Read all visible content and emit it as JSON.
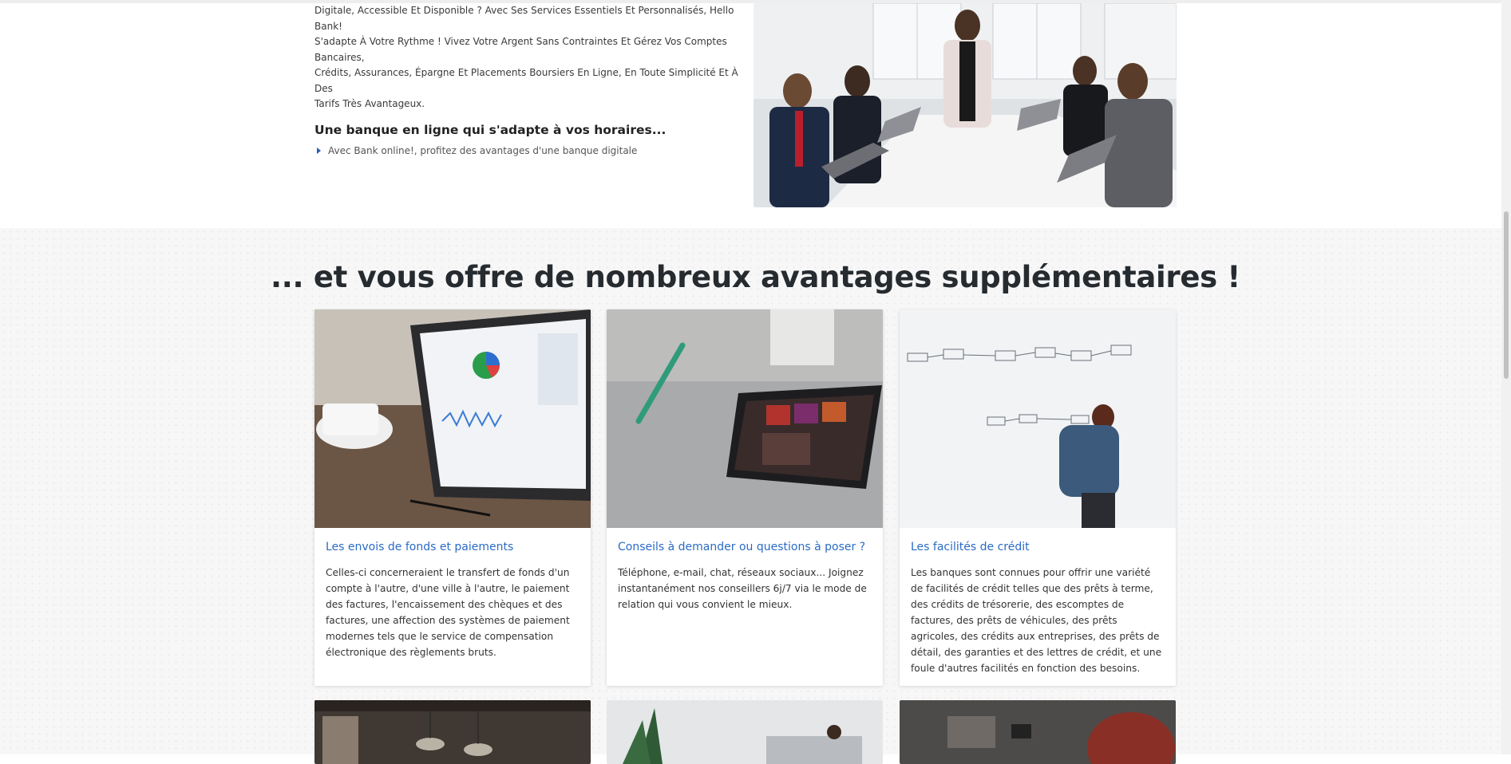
{
  "intro": {
    "paragraph_lines": [
      "Digitale, Accessible Et Disponible ? Avec Ses Services Essentiels Et Personnalisés, Hello Bank!",
      "S'adapte À Votre Rythme ! Vivez Votre Argent Sans Contraintes Et Gérez Vos Comptes Bancaires,",
      "Crédits, Assurances, Épargne Et Placements Boursiers En Ligne, En Toute Simplicité Et À Des",
      "Tarifs Très Avantageux."
    ],
    "heading": "Une banque en ligne qui s'adapte à vos horaires...",
    "bullet": "Avec Bank online!, profitez des avantages d'une banque digitale"
  },
  "advantages": {
    "title": "... et vous offre de nombreux avantages supplémentaires !",
    "cards": [
      {
        "title": "Les envois de fonds et paiements",
        "text": "Celles-ci concerneraient le transfert de fonds d'un compte à l'autre, d'une ville à l'autre, le paiement des factures, l'encaissement des chèques et des factures, une affection des systèmes de paiement modernes tels que le service de compensation électronique des règlements bruts."
      },
      {
        "title": "Conseils à demander ou questions à poser ?",
        "text": "Téléphone, e-mail, chat, réseaux sociaux... Joignez instantanément nos conseillers 6j/7 via le mode de relation qui vous convient le mieux."
      },
      {
        "title": "Les facilités de crédit",
        "text": "Les banques sont connues pour offrir une variété de facilités de crédit telles que des prêts à terme, des crédits de trésorerie, des escomptes de factures, des prêts de véhicules, des prêts agricoles, des crédits aux entreprises, des prêts de détail, des garanties et des lettres de crédit, et une foule d'autres facilités en fonction des besoins."
      }
    ]
  },
  "colors": {
    "link_blue": "#2a6bc4",
    "section_bg": "#f7f7f8",
    "title_dark": "#262b30"
  }
}
